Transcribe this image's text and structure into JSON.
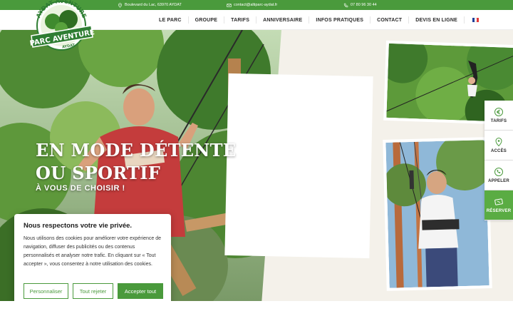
{
  "topbar": {
    "address": "Boulevard du Lac, 63970 AYDAT",
    "email": "contact@altiparc-aydat.fr",
    "phone": "07 80 96 30 44"
  },
  "logo": {
    "line1": "AYDAT AVENTURE",
    "line2": "PARC AVENTURE",
    "line3": "AYDAT"
  },
  "nav": {
    "items": [
      "LE PARC",
      "GROUPE",
      "TARIFS",
      "ANNIVERSAIRE",
      "INFOS PRATIQUES",
      "CONTACT",
      "DEVIS EN LIGNE"
    ],
    "flag_colors": [
      "#1f3f99",
      "#ffffff",
      "#e23a3a"
    ]
  },
  "hero": {
    "title_line1": "EN MODE DÉTENTE",
    "title_line2": "OU SPORTIF",
    "subtitle": "À VOUS DE CHOISIR !"
  },
  "side": {
    "tarifs": "TARIFS",
    "acces": "ACCÈS",
    "appeler": "APPELER",
    "reserver": "RÉSERVER"
  },
  "cookie": {
    "title": "Nous respectons votre vie privée.",
    "text": "Nous utilisons des cookies pour améliorer votre expérience de navigation, diffuser des publicités ou des contenus personnalisés et analyser notre trafic. En cliquant sur « Tout accepter », vous consentez à notre utilisation des cookies.",
    "customize": "Personnaliser",
    "reject": "Tout rejeter",
    "accept": "Accepter tout"
  },
  "colors": {
    "brand_green": "#4a9a3c",
    "accent_green": "#5aac43"
  }
}
